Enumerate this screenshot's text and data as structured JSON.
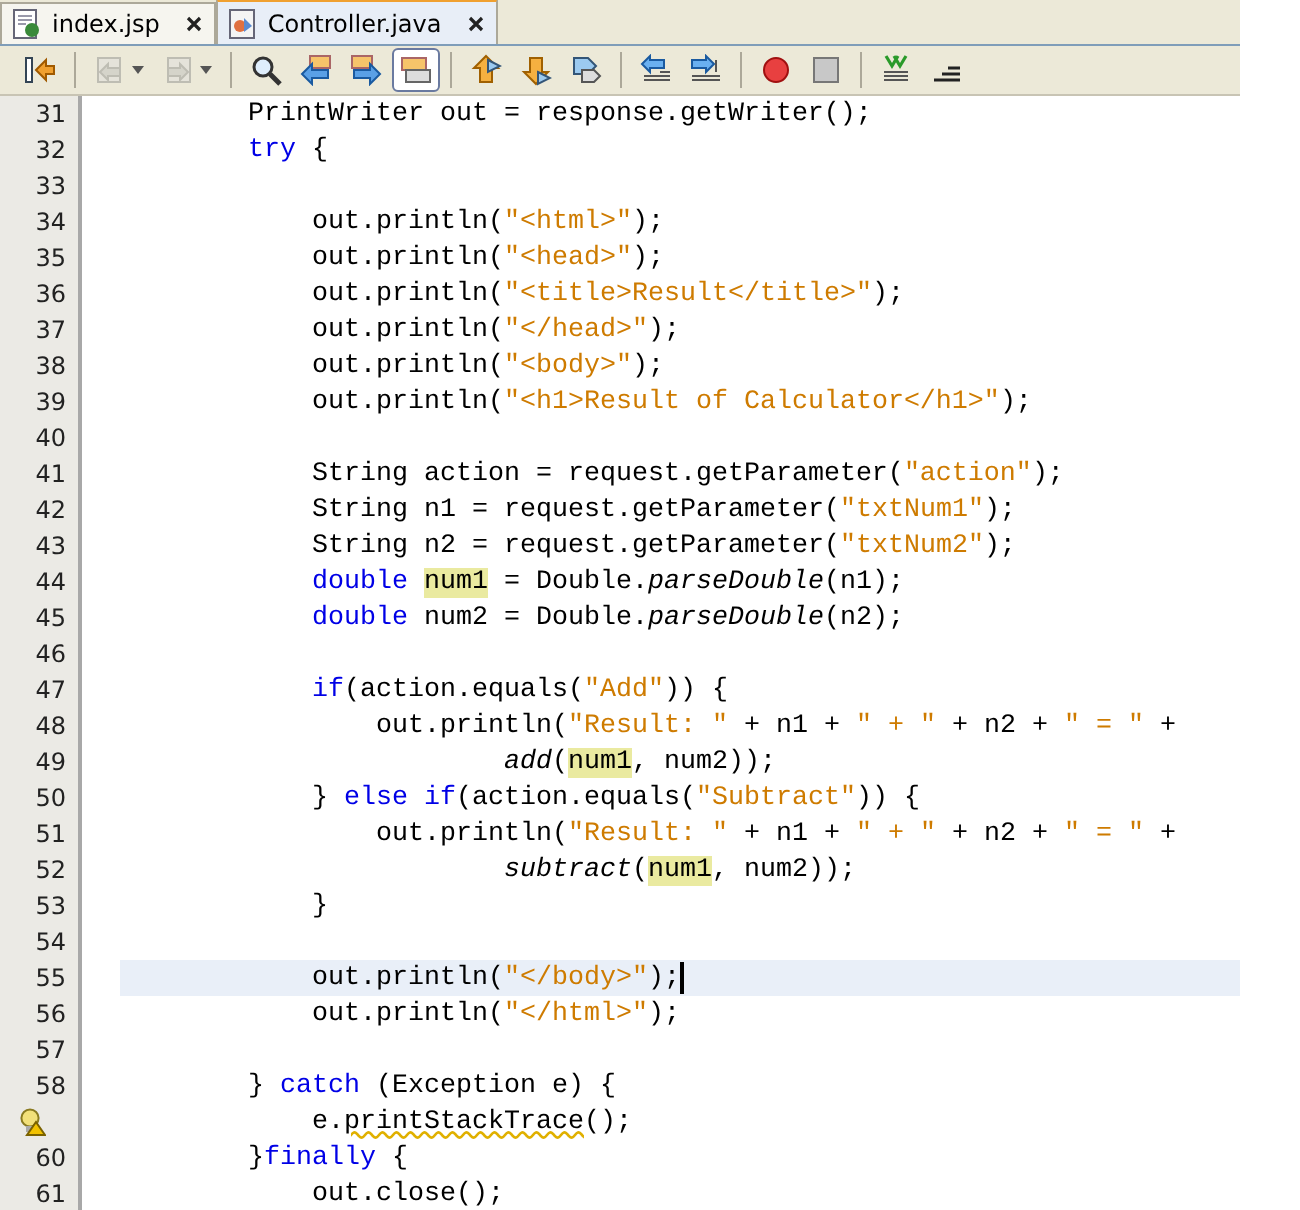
{
  "tabs": [
    {
      "label": "index.jsp",
      "kind": "jsp",
      "selected": false
    },
    {
      "label": "Controller.java",
      "kind": "java",
      "selected": true
    }
  ],
  "toolbar": {
    "groups": [
      {
        "buttons": [
          {
            "kind": "last-edit",
            "disabled": false,
            "selected": false,
            "dropdown": false
          }
        ]
      },
      {
        "buttons": [
          {
            "kind": "back",
            "disabled": true,
            "selected": false,
            "dropdown": true
          },
          {
            "kind": "forward",
            "disabled": true,
            "selected": false,
            "dropdown": true
          }
        ]
      },
      {
        "buttons": [
          {
            "kind": "find",
            "disabled": false,
            "selected": false,
            "dropdown": false
          },
          {
            "kind": "find-prev",
            "disabled": false,
            "selected": false,
            "dropdown": false
          },
          {
            "kind": "find-next",
            "disabled": false,
            "selected": false,
            "dropdown": false
          },
          {
            "kind": "highlight",
            "disabled": false,
            "selected": true,
            "dropdown": false
          }
        ]
      },
      {
        "buttons": [
          {
            "kind": "prev-bookmark",
            "disabled": false,
            "selected": false,
            "dropdown": false
          },
          {
            "kind": "next-bookmark",
            "disabled": false,
            "selected": false,
            "dropdown": false
          },
          {
            "kind": "toggle-bookmark",
            "disabled": false,
            "selected": false,
            "dropdown": false
          }
        ]
      },
      {
        "buttons": [
          {
            "kind": "shift-left",
            "disabled": false,
            "selected": false,
            "dropdown": false
          },
          {
            "kind": "shift-right",
            "disabled": false,
            "selected": false,
            "dropdown": false
          }
        ]
      },
      {
        "buttons": [
          {
            "kind": "record",
            "disabled": false,
            "selected": false,
            "dropdown": false
          },
          {
            "kind": "stop",
            "disabled": false,
            "selected": false,
            "dropdown": false
          }
        ]
      },
      {
        "buttons": [
          {
            "kind": "comment",
            "disabled": false,
            "selected": false,
            "dropdown": false
          },
          {
            "kind": "uncomment",
            "disabled": false,
            "selected": false,
            "dropdown": false
          }
        ]
      }
    ]
  },
  "lines": [
    {
      "number": "31",
      "kind": "statement",
      "current": false,
      "tokens": [
        {
          "text": "PrintWriter out = response.getWriter();",
          "kind": "plain"
        }
      ]
    },
    {
      "number": "32",
      "kind": "statement",
      "current": false,
      "tokens": [
        {
          "text": "try",
          "kind": "keyword"
        },
        {
          "text": " {",
          "kind": "plain"
        }
      ],
      "children": [
        {
          "number": "33",
          "kind": "statement",
          "current": false
        },
        {
          "number": "34",
          "kind": "statement",
          "current": false,
          "tokens": [
            {
              "text": "out.println(",
              "kind": "plain"
            },
            {
              "text": "\"<html>\"",
              "kind": "string"
            },
            {
              "text": ");",
              "kind": "plain"
            }
          ]
        },
        {
          "number": "35",
          "kind": "statement",
          "current": false,
          "tokens": [
            {
              "text": "out.println(",
              "kind": "plain"
            },
            {
              "text": "\"<head>\"",
              "kind": "string"
            },
            {
              "text": ");",
              "kind": "plain"
            }
          ]
        },
        {
          "number": "36",
          "kind": "statement",
          "current": false,
          "tokens": [
            {
              "text": "out.println(",
              "kind": "plain"
            },
            {
              "text": "\"<title>Result</title>\"",
              "kind": "string"
            },
            {
              "text": ");",
              "kind": "plain"
            }
          ]
        },
        {
          "number": "37",
          "kind": "statement",
          "current": false,
          "tokens": [
            {
              "text": "out.println(",
              "kind": "plain"
            },
            {
              "text": "\"</head>\"",
              "kind": "string"
            },
            {
              "text": ");",
              "kind": "plain"
            }
          ]
        },
        {
          "number": "38",
          "kind": "statement",
          "current": false,
          "tokens": [
            {
              "text": "out.println(",
              "kind": "plain"
            },
            {
              "text": "\"<body>\"",
              "kind": "string"
            },
            {
              "text": ");",
              "kind": "plain"
            }
          ]
        },
        {
          "number": "39",
          "kind": "statement",
          "current": false,
          "tokens": [
            {
              "text": "out.println(",
              "kind": "plain"
            },
            {
              "text": "\"<h1>Result of Calculator</h1>\"",
              "kind": "string"
            },
            {
              "text": ");",
              "kind": "plain"
            }
          ]
        },
        {
          "number": "40",
          "kind": "statement",
          "current": false
        },
        {
          "number": "41",
          "kind": "statement",
          "current": false,
          "tokens": [
            {
              "text": "String action = request.getParameter(",
              "kind": "plain"
            },
            {
              "text": "\"action\"",
              "kind": "string"
            },
            {
              "text": ");",
              "kind": "plain"
            }
          ]
        },
        {
          "number": "42",
          "kind": "statement",
          "current": false,
          "tokens": [
            {
              "text": "String n1 = request.getParameter(",
              "kind": "plain"
            },
            {
              "text": "\"txtNum1\"",
              "kind": "string"
            },
            {
              "text": ");",
              "kind": "plain"
            }
          ]
        },
        {
          "number": "43",
          "kind": "statement",
          "current": false,
          "tokens": [
            {
              "text": "String n2 = request.getParameter(",
              "kind": "plain"
            },
            {
              "text": "\"txtNum2\"",
              "kind": "string"
            },
            {
              "text": ");",
              "kind": "plain"
            }
          ]
        },
        {
          "number": "44",
          "kind": "statement",
          "current": false,
          "tokens": [
            {
              "text": "double ",
              "kind": "keyword"
            },
            {
              "text": "num1",
              "kind": "occurrence"
            },
            {
              "text": " = Double.",
              "kind": "plain"
            },
            {
              "text": "parseDouble",
              "kind": "method"
            },
            {
              "text": "(n1);",
              "kind": "plain"
            }
          ]
        },
        {
          "number": "45",
          "kind": "statement",
          "current": false,
          "tokens": [
            {
              "text": "double",
              "kind": "keyword"
            },
            {
              "text": " num2 = Double.",
              "kind": "plain"
            },
            {
              "text": "parseDouble",
              "kind": "method"
            },
            {
              "text": "(n2);",
              "kind": "plain"
            }
          ]
        },
        {
          "number": "46",
          "kind": "statement",
          "current": false
        },
        {
          "number": "47",
          "kind": "statement",
          "current": false,
          "tokens": [
            {
              "text": "if",
              "kind": "keyword"
            },
            {
              "text": "(action.equals(",
              "kind": "plain"
            },
            {
              "text": "\"Add\"",
              "kind": "string"
            },
            {
              "text": ")) {",
              "kind": "plain"
            }
          ],
          "children": [
            {
              "number": "48",
              "kind": "statement",
              "current": false,
              "tokens": [
                {
                  "text": "out.println(",
                  "kind": "plain"
                },
                {
                  "text": "\"Result: \"",
                  "kind": "string"
                },
                {
                  "text": " + n1 + ",
                  "kind": "plain"
                },
                {
                  "text": "\" + \"",
                  "kind": "string"
                },
                {
                  "text": " + n2 + ",
                  "kind": "plain"
                },
                {
                  "text": "\" = \"",
                  "kind": "string"
                },
                {
                  "text": " +",
                  "kind": "plain"
                }
              ],
              "children": [
                {
                  "number": "49",
                  "kind": "continuation",
                  "current": false,
                  "tokens": [
                    {
                      "text": "add",
                      "kind": "method"
                    },
                    {
                      "text": "(",
                      "kind": "plain"
                    },
                    {
                      "text": "num1",
                      "kind": "occurrence"
                    },
                    {
                      "text": ", num2));",
                      "kind": "plain"
                    }
                  ]
                }
              ]
            }
          ]
        },
        {
          "number": "50",
          "kind": "statement",
          "current": false,
          "tokens": [
            {
              "text": "} ",
              "kind": "plain"
            },
            {
              "text": "else ",
              "kind": "keyword"
            },
            {
              "text": "if",
              "kind": "keyword"
            },
            {
              "text": "(action.equals(",
              "kind": "plain"
            },
            {
              "text": "\"Subtract\"",
              "kind": "string"
            },
            {
              "text": ")) {",
              "kind": "plain"
            }
          ],
          "children": [
            {
              "number": "51",
              "kind": "statement",
              "current": false,
              "tokens": [
                {
                  "text": "out.println(",
                  "kind": "plain"
                },
                {
                  "text": "\"Result: \"",
                  "kind": "string"
                },
                {
                  "text": " + n1 + ",
                  "kind": "plain"
                },
                {
                  "text": "\" + \"",
                  "kind": "string"
                },
                {
                  "text": " + n2 + ",
                  "kind": "plain"
                },
                {
                  "text": "\" = \"",
                  "kind": "string"
                },
                {
                  "text": " +",
                  "kind": "plain"
                }
              ],
              "children": [
                {
                  "number": "52",
                  "kind": "continuation",
                  "current": false,
                  "tokens": [
                    {
                      "text": "subtract",
                      "kind": "method"
                    },
                    {
                      "text": "(",
                      "kind": "plain"
                    },
                    {
                      "text": "num1",
                      "kind": "occurrence"
                    },
                    {
                      "text": ", num2));",
                      "kind": "plain"
                    }
                  ]
                }
              ]
            }
          ]
        },
        {
          "number": "53",
          "kind": "statement",
          "current": false,
          "tokens": [
            {
              "text": "}",
              "kind": "plain"
            }
          ]
        },
        {
          "number": "54",
          "kind": "statement",
          "current": false
        },
        {
          "number": "55",
          "kind": "statement",
          "current": true,
          "tokens": [
            {
              "text": "out.println(",
              "kind": "plain"
            },
            {
              "text": "\"</body>\"",
              "kind": "string"
            },
            {
              "text": ");",
              "kind": "plain"
            }
          ]
        },
        {
          "number": "56",
          "kind": "statement",
          "current": false,
          "tokens": [
            {
              "text": "out.println(",
              "kind": "plain"
            },
            {
              "text": "\"</html>\"",
              "kind": "string"
            },
            {
              "text": ");",
              "kind": "plain"
            }
          ]
        },
        {
          "number": "57",
          "kind": "statement",
          "current": false
        }
      ]
    },
    {
      "number": "58",
      "kind": "statement",
      "current": false,
      "tokens": [
        {
          "text": "} ",
          "kind": "plain"
        },
        {
          "text": "catch",
          "kind": "keyword"
        },
        {
          "text": " (Exception e) {",
          "kind": "plain"
        }
      ],
      "children": [
        {
          "kind": "hint",
          "current": false,
          "tokens": [
            {
              "text": "e.",
              "kind": "plain"
            },
            {
              "text": "printStackTrace",
              "kind": "warning"
            },
            {
              "text": "();",
              "kind": "plain"
            }
          ]
        }
      ]
    },
    {
      "number": "60",
      "kind": "statement",
      "current": false,
      "tokens": [
        {
          "text": "}",
          "kind": "plain"
        },
        {
          "text": "finally",
          "kind": "keyword"
        },
        {
          "text": " {",
          "kind": "plain"
        }
      ],
      "children": [
        {
          "number": "61",
          "kind": "statement",
          "current": false,
          "tokens": [
            {
              "text": "out.close();",
              "kind": "plain"
            }
          ]
        }
      ]
    }
  ]
}
